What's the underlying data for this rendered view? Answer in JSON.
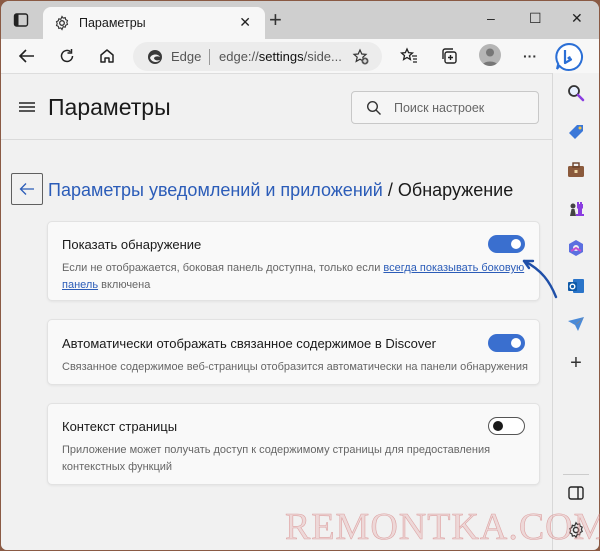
{
  "browser": {
    "tab_title": "Параметры",
    "new_tab": "+",
    "window_controls": {
      "minimize": "–",
      "maximize": "☐",
      "close": "✕"
    },
    "tab_close": "✕",
    "address": {
      "brand": "Edge",
      "url_prefix": "edge://",
      "url_bold": "settings",
      "url_rest": "/side..."
    },
    "more": "···"
  },
  "settings": {
    "title": "Параметры",
    "search_placeholder": "Поиск настроек",
    "breadcrumb": {
      "parent": "Параметры уведомлений и приложений",
      "separator": " / ",
      "current": "Обнаружение"
    },
    "cards": [
      {
        "title": "Показать обнаружение",
        "desc_before": "Если не отображается, боковая панель доступна, только если ",
        "desc_link": "всегда показывать боковую панель",
        "desc_after": " включена",
        "enabled": true
      },
      {
        "title": "Автоматически отображать связанное содержимое в Discover",
        "desc": "Связанное содержимое веб-страницы отобразится автоматически на панели обнаружения",
        "enabled": true
      },
      {
        "title": "Контекст страницы",
        "desc": "Приложение может получать доступ к содержимому страницы для предоставления контекстных функций",
        "enabled": false
      }
    ]
  },
  "sidebar": {
    "items": [
      "search-icon",
      "shopping-tag-icon",
      "tools-briefcase-icon",
      "games-chess-icon",
      "microsoft365-icon",
      "outlook-icon",
      "drop-send-icon",
      "add-icon"
    ],
    "add": "+"
  },
  "colors": {
    "accent": "#3a6fcf",
    "link": "#2b5cb8"
  },
  "watermark": "REMONTKA.COM"
}
